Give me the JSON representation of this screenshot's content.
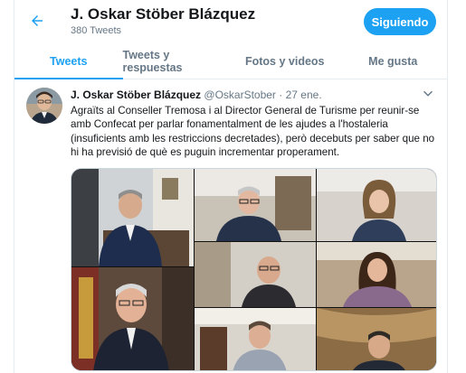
{
  "header": {
    "title": "J. Oskar Stöber Blázquez",
    "tweet_count": "380 Tweets",
    "follow_label": "Siguiendo"
  },
  "tabs": [
    {
      "label": "Tweets",
      "active": true
    },
    {
      "label": "Tweets y respuestas",
      "active": false
    },
    {
      "label": "Fotos y videos",
      "active": false
    },
    {
      "label": "Me gusta",
      "active": false
    }
  ],
  "tweet": {
    "name": "J. Oskar Stöber Blázquez",
    "handle": "@OskarStober",
    "separator": "·",
    "date": "27 ene.",
    "text": "Agraïts al Conseller Tremosa i al Director General de Turisme per reunir-se amb Confecat per parlar fonamentalment de les ajudes a l'hostaleria (insuficients amb les restriccions decretades), però decebuts per saber que no hi ha previsió de què es puguin incrementar properament."
  },
  "colors": {
    "accent": "#1da1f2",
    "text": "#14171a",
    "muted": "#657786",
    "border": "#e6ecf0"
  },
  "icons": {
    "back": "arrow-left-icon",
    "menu": "chevron-down-icon"
  }
}
